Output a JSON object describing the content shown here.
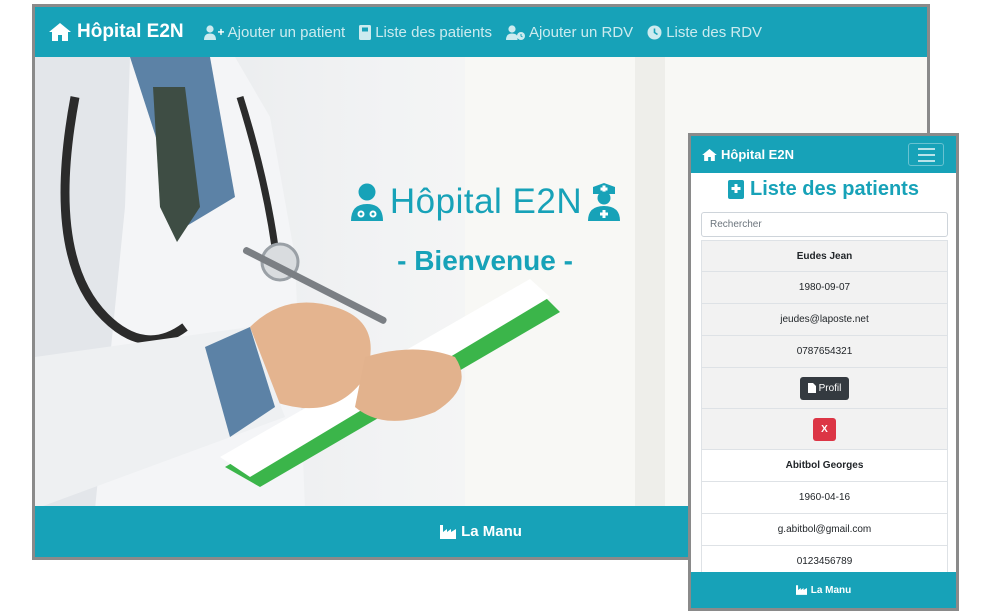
{
  "desktop": {
    "brand": "Hôpital E2N",
    "nav": [
      {
        "label": "Ajouter un patient"
      },
      {
        "label": "Liste des patients"
      },
      {
        "label": "Ajouter un RDV"
      },
      {
        "label": "Liste des RDV"
      }
    ],
    "hero": {
      "title": "Hôpital E2N",
      "subtitle": "- Bienvenue -"
    },
    "footer": "La Manu"
  },
  "mobile": {
    "brand": "Hôpital E2N",
    "page_title": "Liste des patients",
    "search_placeholder": "Rechercher",
    "patients": [
      {
        "name": "Eudes Jean",
        "birthdate": "1980-09-07",
        "email": "jeudes@laposte.net",
        "phone": "0787654321"
      },
      {
        "name": "Abitbol Georges",
        "birthdate": "1960-04-16",
        "email": "g.abitbol@gmail.com",
        "phone": "0123456789"
      }
    ],
    "profile_button": "Profil",
    "delete_button": "X",
    "footer": "La Manu"
  },
  "colors": {
    "primary": "#17a2b8",
    "dark": "#343a40",
    "danger": "#dc3545"
  },
  "icons": [
    "home-icon",
    "user-plus-icon",
    "notebook-icon",
    "user-clock-icon",
    "clock-icon",
    "doctor-icon",
    "nurse-icon",
    "industry-icon",
    "file-icon",
    "hamburger-icon"
  ]
}
